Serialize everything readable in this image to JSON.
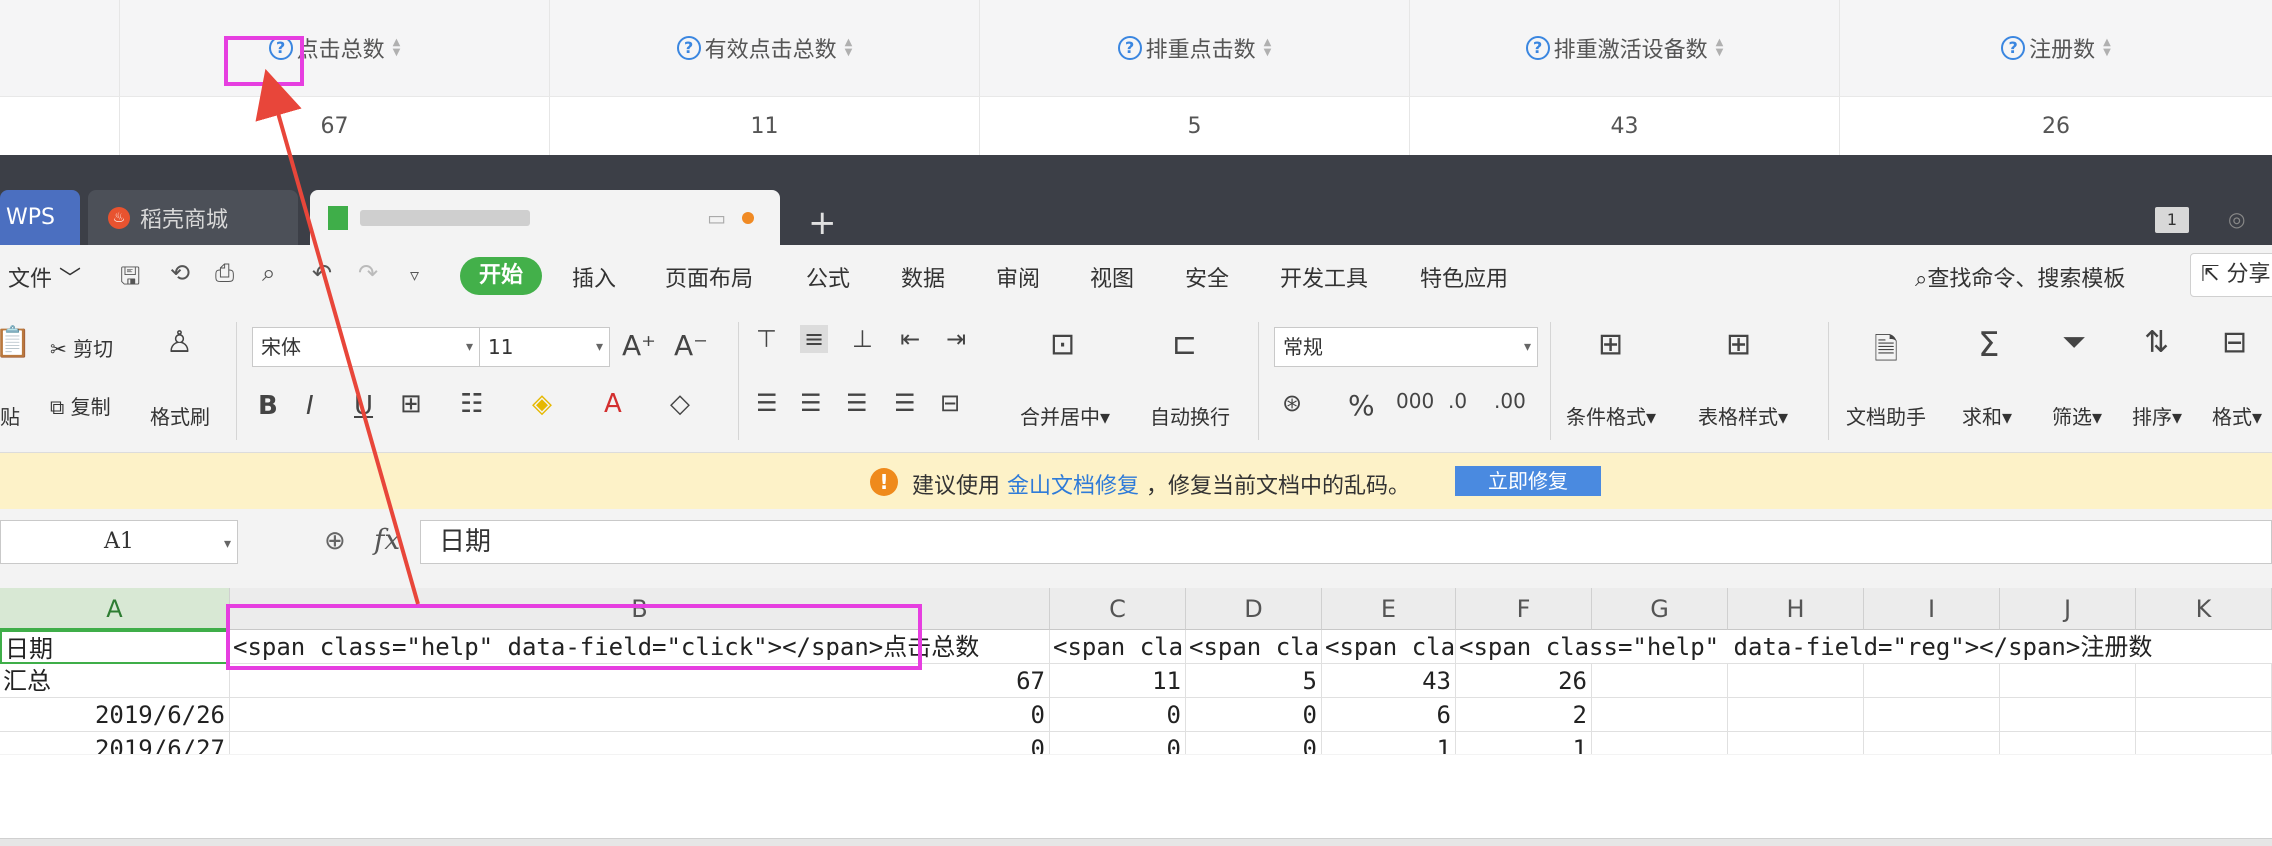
{
  "report": {
    "columns": [
      {
        "label": "点击总数",
        "value": "67"
      },
      {
        "label": "有效点击总数",
        "value": "11"
      },
      {
        "label": "排重点击数",
        "value": "5"
      },
      {
        "label": "排重激活设备数",
        "value": "43"
      },
      {
        "label": "注册数",
        "value": "26"
      }
    ],
    "help_glyph": "?",
    "sort_glyph_up": "▲",
    "sort_glyph_down": "▼"
  },
  "window": {
    "tabs": {
      "wps": "WPS",
      "store": "稻壳商城",
      "new_tab": "+"
    },
    "badge": "1"
  },
  "menu": {
    "file": "文件",
    "start": "开始",
    "items": [
      "插入",
      "页面布局",
      "公式",
      "数据",
      "审阅",
      "视图",
      "安全",
      "开发工具",
      "特色应用"
    ],
    "search": "查找命令、搜索模板",
    "share": "分享"
  },
  "ribbon": {
    "cut": "剪切",
    "copy": "复制",
    "paste_fragment": "贴",
    "format_painter": "格式刷",
    "font_name": "宋体",
    "font_size": "11",
    "merge_center": "合并居中",
    "wrap": "自动换行",
    "number_format": "常规",
    "conditional": "条件格式",
    "table_style": "表格样式",
    "doc_helper": "文档助手",
    "sum": "求和",
    "filter": "筛选",
    "sort": "排序",
    "format": "格式"
  },
  "notice": {
    "prefix": "建议使用",
    "link": "金山文档修复",
    "suffix": "，修复当前文档中的乱码。",
    "button": "立即修复"
  },
  "formula": {
    "cell_ref": "A1",
    "fx": "fx",
    "content": "日期"
  },
  "sheet": {
    "columns": [
      "A",
      "B",
      "C",
      "D",
      "E",
      "F",
      "G",
      "H",
      "I",
      "J",
      "K"
    ],
    "rows": [
      [
        "日期",
        "<span class=\"help\" data-field=\"click\"></span>点击总数",
        "<span cla",
        "<span cla",
        "<span cla",
        "<span class=\"help\" data-field=\"reg\"></span>注册数",
        "",
        "",
        "",
        "",
        ""
      ],
      [
        "汇总",
        "67",
        "11",
        "5",
        "43",
        "26",
        "",
        "",
        "",
        "",
        ""
      ],
      [
        "2019/6/26",
        "0",
        "0",
        "0",
        "6",
        "2",
        "",
        "",
        "",
        "",
        ""
      ],
      [
        "2019/6/27",
        "0",
        "0",
        "0",
        "1",
        "1",
        "",
        "",
        "",
        "",
        ""
      ]
    ]
  },
  "colors": {
    "highlight": "#e63ee0",
    "arrow": "#e8463a",
    "wps_green": "#43b04a",
    "link_blue": "#2f7bd8"
  }
}
